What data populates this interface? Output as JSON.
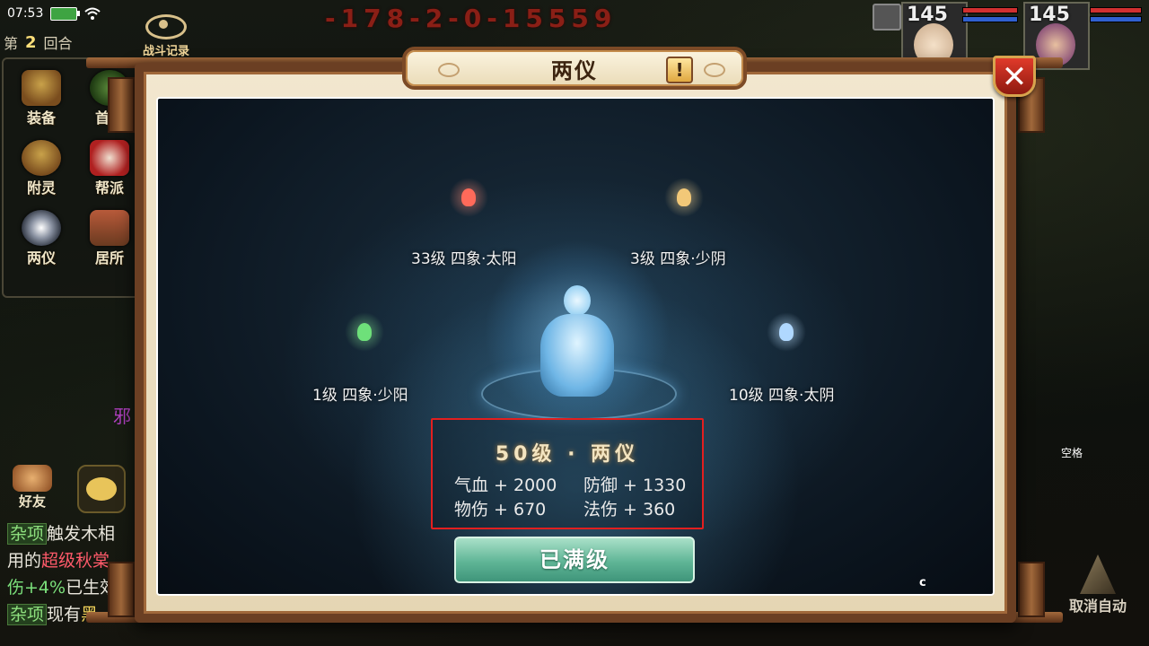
{
  "status_bar": {
    "time": "07:53"
  },
  "battle": {
    "damage_number": "-178-2-0-15559",
    "round_prefix": "第",
    "round_number": "2",
    "round_suffix": "回合",
    "battle_record_label": "战斗记录"
  },
  "left_menu": {
    "items": [
      {
        "label": "装备"
      },
      {
        "label": "首饰"
      },
      {
        "label": "附灵"
      },
      {
        "label": "帮派"
      },
      {
        "label": "两仪"
      },
      {
        "label": "居所"
      }
    ]
  },
  "social": {
    "friends_label": "好友"
  },
  "side_char": "邪",
  "chat": {
    "line1_tag": "杂项",
    "line1_text": "触发木相",
    "line2_a": "用的",
    "line2_b": "超级秋棠",
    "line3_a": "伤+4%",
    "line3_b": "已生效",
    "line4_tag": "杂项",
    "line4_a": "现有",
    "line4_b": "黑"
  },
  "portraits": [
    {
      "level": "145"
    },
    {
      "level": "145"
    }
  ],
  "right_side": {
    "space_label": "空格",
    "cancel_auto_label": "取消自动"
  },
  "dialog": {
    "title": "两仪",
    "info_label": "!",
    "close_label": "✕",
    "nodes": [
      {
        "label": "33级  四象·太阳",
        "color": "#ff6a5a"
      },
      {
        "label": "3级  四象·少阴",
        "color": "#f2c878"
      },
      {
        "label": "1级  四象·少阳",
        "color": "#6ee07a"
      },
      {
        "label": "10级  四象·太阴",
        "color": "#b0d8ff"
      }
    ],
    "stats_title": "50级 · 两仪",
    "stats": {
      "hp": "气血 + 2000",
      "defense": "防御 + 1330",
      "phys_damage": "物伤 + 670",
      "magic_damage": "法伤 + 360"
    },
    "max_level_label": "已满级",
    "corner_mark": "c"
  },
  "colors": {
    "frame_brown": "#6b3f23",
    "parchment": "#f2e7cf",
    "highlight_red": "#e21f1f",
    "button_green": "#5fb596",
    "close_red": "#e03a2a"
  }
}
